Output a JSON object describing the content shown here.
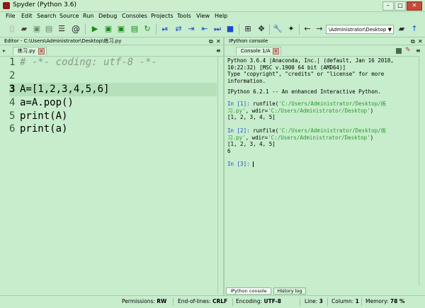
{
  "window": {
    "title": "Spyder (Python 3.6)",
    "min": "–",
    "max": "□",
    "close": "✕"
  },
  "menu": [
    "File",
    "Edit",
    "Search",
    "Source",
    "Run",
    "Debug",
    "Consoles",
    "Projects",
    "Tools",
    "View",
    "Help"
  ],
  "toolbar": {
    "path": "\\Administrator\\Desktop",
    "dropdown": "▼"
  },
  "editor": {
    "header": "Editor - C:\\Users\\Administrator\\Desktop\\练习.py",
    "tab": "练习.py",
    "lines": [
      {
        "n": "1",
        "text": "# -*- coding: utf-8 -*-"
      },
      {
        "n": "2",
        "text": ""
      },
      {
        "n": "3",
        "text": "A=[1,2,3,4,5,6]"
      },
      {
        "n": "4",
        "text": "a=A.pop()"
      },
      {
        "n": "5",
        "text": "print(A)"
      },
      {
        "n": "6",
        "text": "print(a)"
      }
    ]
  },
  "console": {
    "header": "IPython console",
    "tab": "Console 1/A",
    "banner": [
      "Python 3.6.4 |Anaconda, Inc.| (default, Jan 16 2018,",
      "10:22:32) [MSC v.1900 64 bit (AMD64)]",
      "Type \"copyright\", \"credits\" or \"license\" for more",
      "information.",
      "",
      "IPython 6.2.1 -- An enhanced Interactive Python."
    ],
    "in1_prompt": "In [1]:",
    "in1_cmd": " runfile(",
    "in1_arg1": "'C:/Users/Administrator/Desktop/练",
    "in1_arg1b": "习.py'",
    "in1_mid": ", wdir=",
    "in1_arg2": "'C:/Users/Administrator/Desktop'",
    "in1_end": ")",
    "out1": "[1, 2, 3, 4, 5]",
    "in2_prompt": "In [2]:",
    "out2a": "[1, 2, 3, 4, 5]",
    "out2b": "6",
    "in3_prompt": "In [3]:"
  },
  "bottom_tabs": {
    "ipython": "IPython console",
    "history": "History log"
  },
  "status": {
    "permissions_label": "Permissions:",
    "permissions": "RW",
    "eol_label": "End-of-lines:",
    "eol": "CRLF",
    "encoding_label": "Encoding:",
    "encoding": "UTF-8",
    "line_label": "Line:",
    "line": "3",
    "column_label": "Column:",
    "column": "1",
    "memory_label": "Memory:",
    "memory": "78 %"
  }
}
